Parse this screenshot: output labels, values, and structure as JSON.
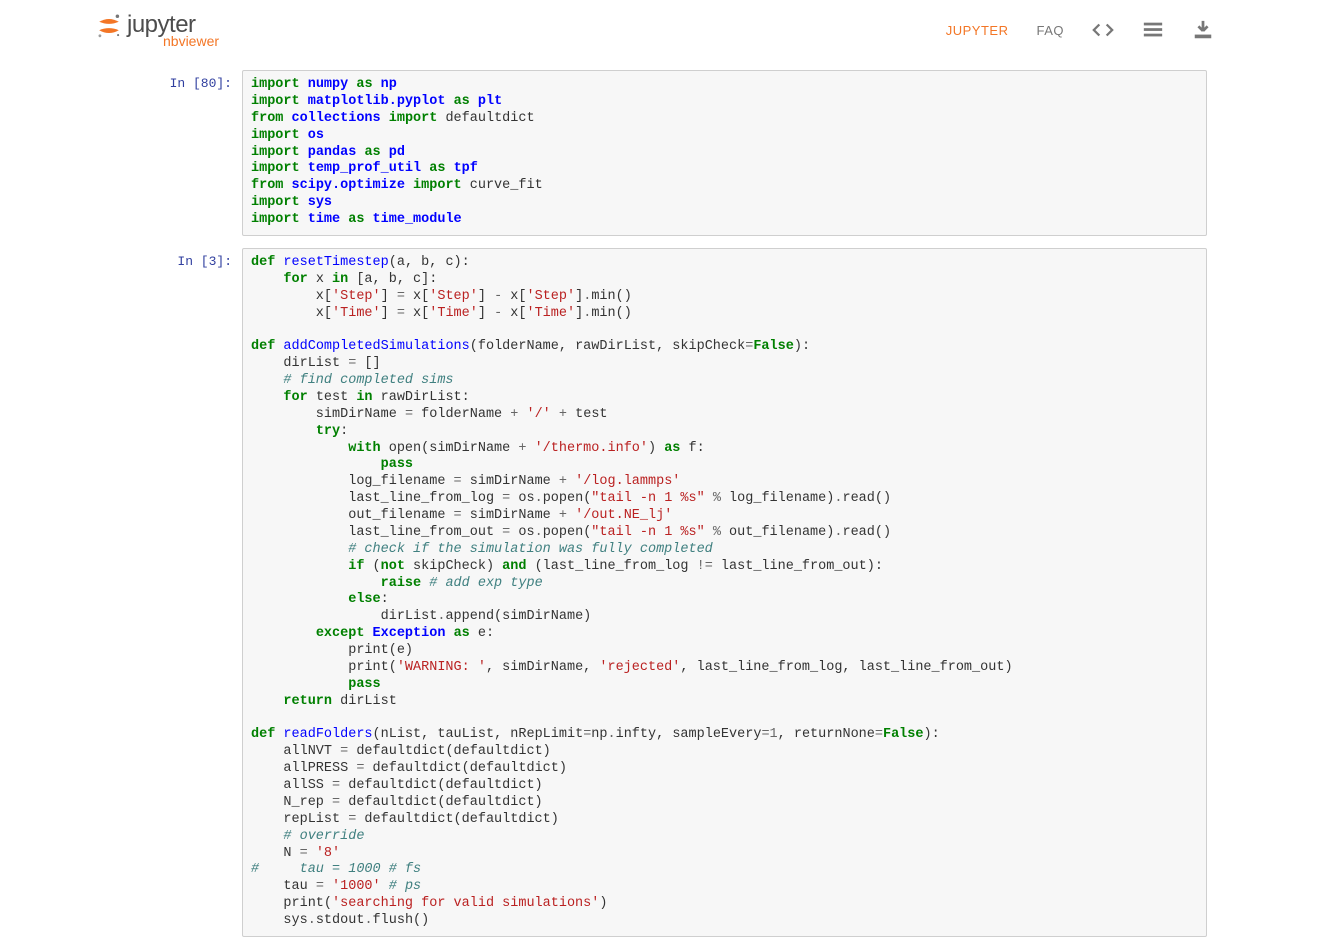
{
  "header": {
    "logo_main": "jupyter",
    "logo_sub": "nbviewer",
    "nav": {
      "jupyter": "JUPYTER",
      "faq": "FAQ"
    }
  },
  "cells": [
    {
      "prompt": "In [80]:"
    },
    {
      "prompt": "In [3]:"
    }
  ]
}
